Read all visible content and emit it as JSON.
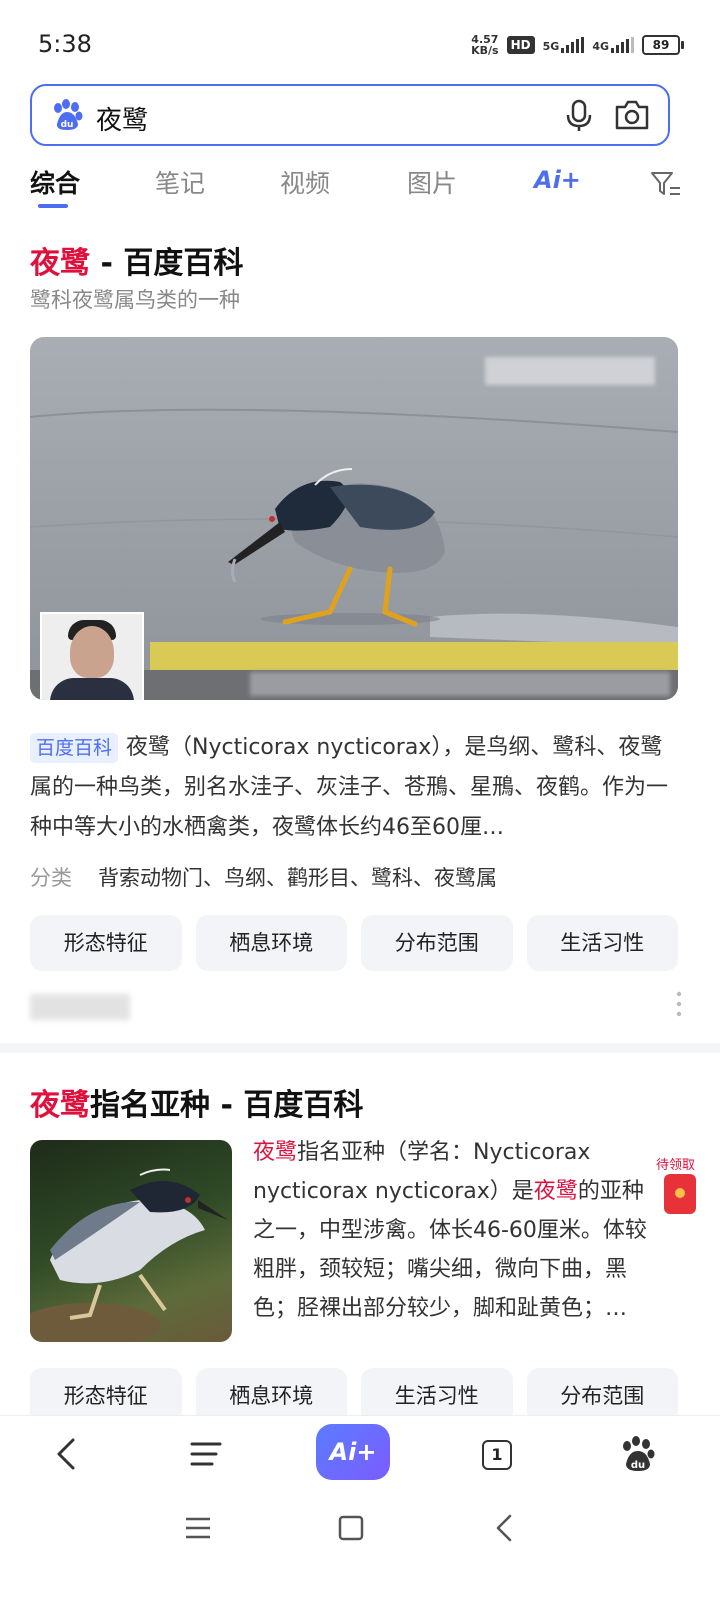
{
  "status_bar": {
    "time": "5:38",
    "net_speed_value": "4.57",
    "net_speed_unit": "KB/s",
    "hd_badge": "HD",
    "net1": "5G",
    "net2": "4G",
    "battery": "89"
  },
  "search": {
    "query": "夜鹭"
  },
  "tabs": [
    {
      "label": "综合",
      "active": true
    },
    {
      "label": "笔记",
      "active": false
    },
    {
      "label": "视频",
      "active": false
    },
    {
      "label": "图片",
      "active": false
    }
  ],
  "ai_tab": "Ai+",
  "result1": {
    "title_highlight": "夜鹭",
    "title_rest": " - 百度百科",
    "subtitle": "鹭科夜鹭属鸟类的一种",
    "source_tag": "百度百科",
    "description": "夜鹭（Nycticorax nycticorax），是鸟纲、鹭科、夜鹭属的一种鸟类，别名水洼子、灰洼子、苍鳽、星鳽、夜鹤。作为一种中等大小的水栖禽类，夜鹭体长约46至60厘…",
    "category_label": "分类",
    "category_value": "背索动物门、鸟纲、鹳形目、鹭科、夜鹭属",
    "chips": [
      "形态特征",
      "栖息环境",
      "分布范围",
      "生活习性"
    ]
  },
  "result2": {
    "title_highlight": "夜鹭",
    "title_rest": "指名亚种 - 百度百科",
    "desc_hl1": "夜鹭",
    "desc_part1": "指名亚种（学名：Nycticorax nycticorax nycticorax）是",
    "desc_hl2": "夜鹭",
    "desc_part2": "的亚种之一，中型涉禽。体长46-60厘米。体较粗胖，颈较短；嘴尖细，微向下曲，黑色；胫裸出部分较少，脚和趾黄色；…",
    "chips": [
      "形态特征",
      "栖息环境",
      "生活习性",
      "分布范围"
    ]
  },
  "red_packet": {
    "label": "待领取"
  },
  "bottom_nav": {
    "ai_label": "Ai+",
    "tab_count": "1"
  },
  "colors": {
    "accent": "#4e6ef2",
    "highlight": "#e0103d"
  }
}
